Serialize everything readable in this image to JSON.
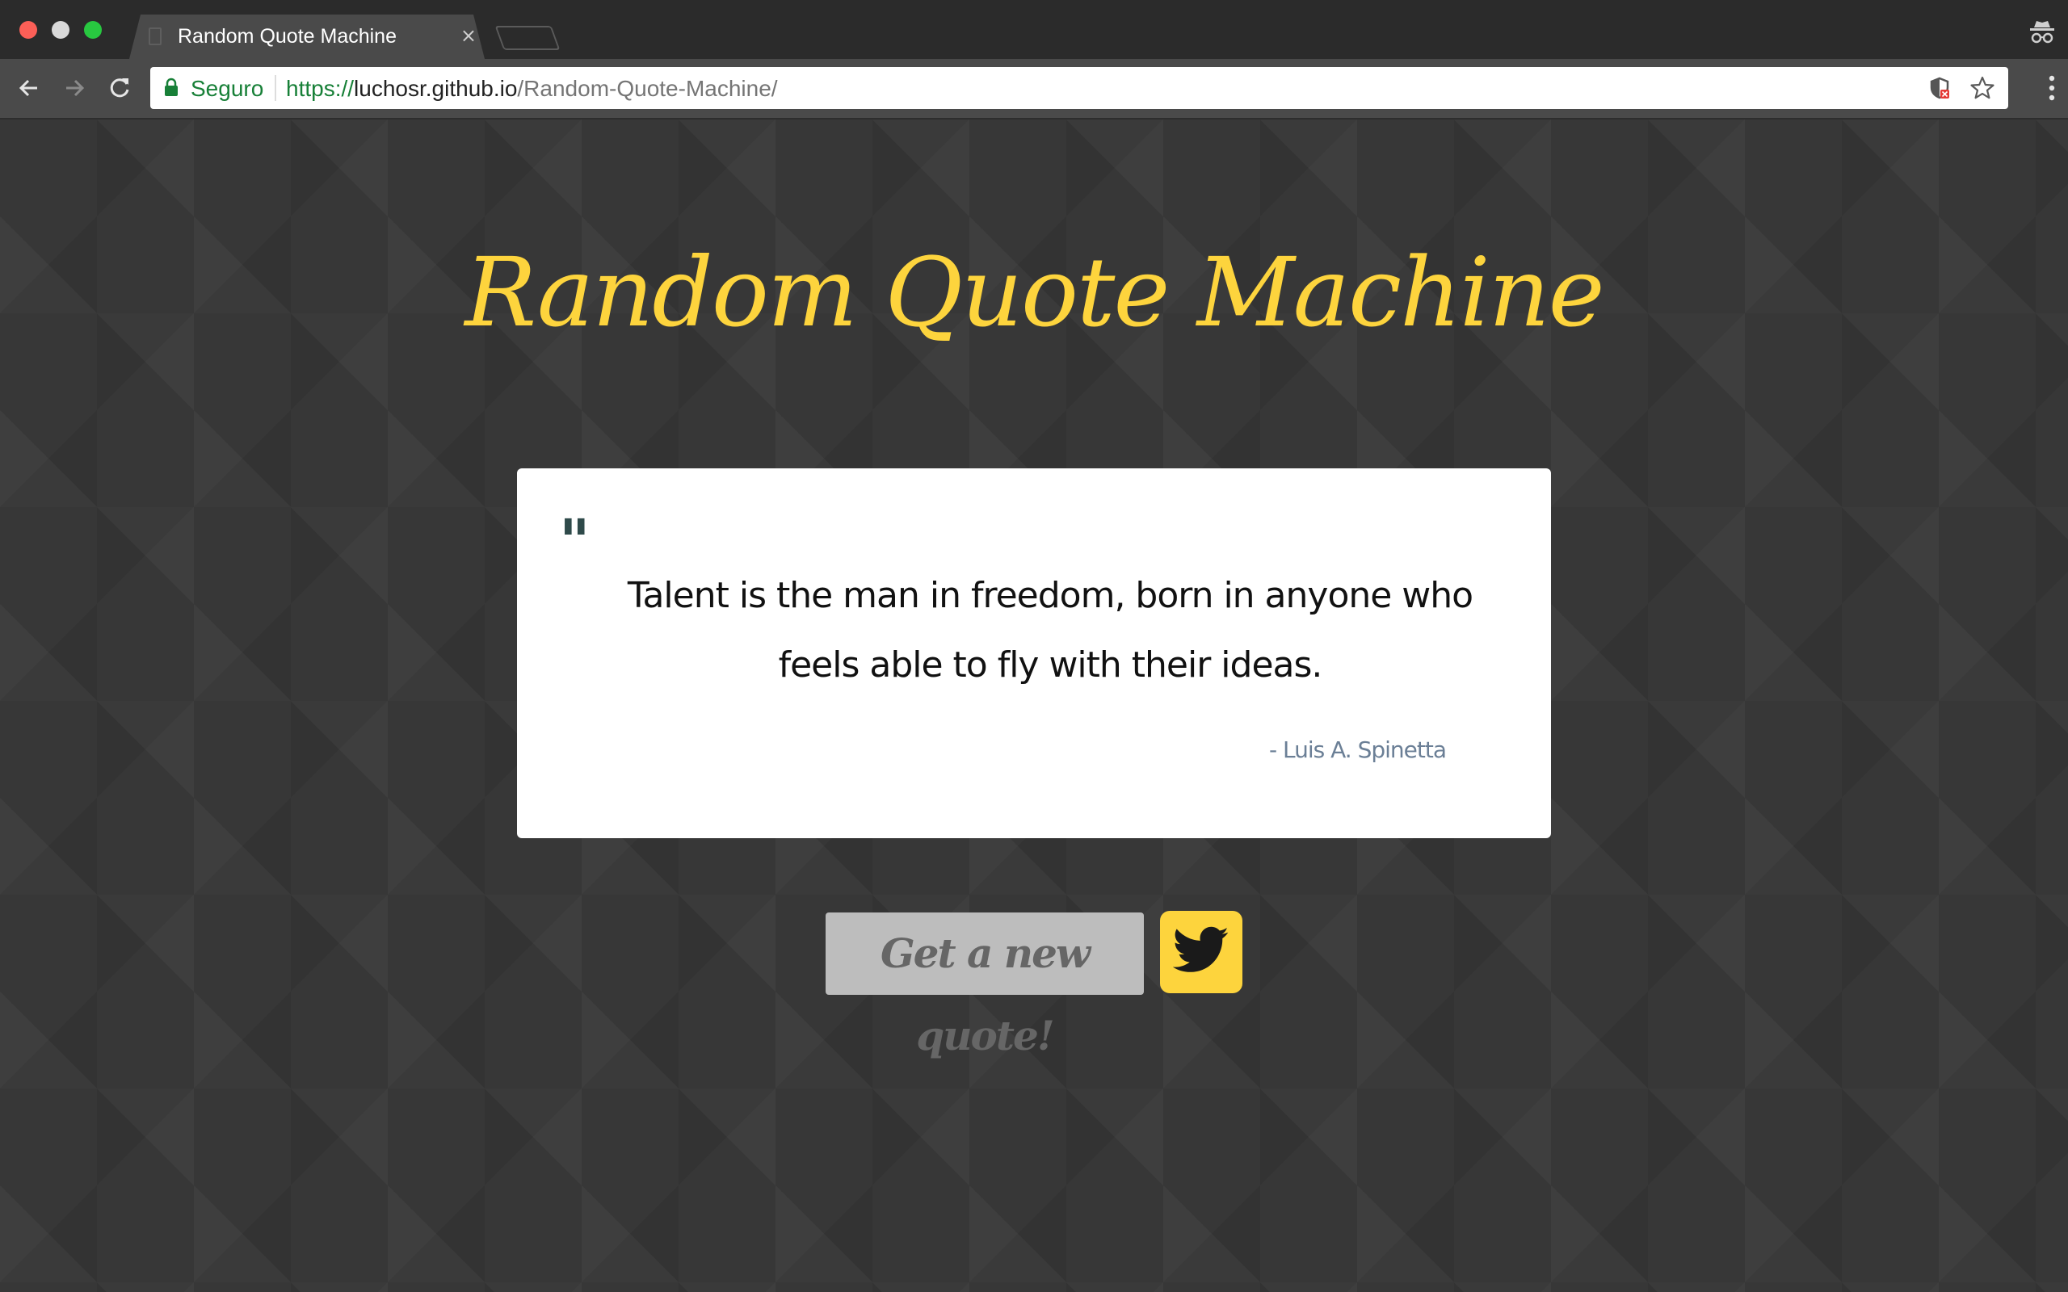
{
  "browser": {
    "tab": {
      "title": "Random Quote Machine",
      "close_symbol": "×",
      "favicon": "document-icon"
    },
    "toolbar": {
      "back_icon": "arrow-left-icon",
      "forward_icon": "arrow-right-icon",
      "reload_icon": "reload-icon",
      "secure_label": "Seguro",
      "url": {
        "scheme": "https://",
        "host": "luchosr.github.io",
        "path": "/Random-Quote-Machine/"
      },
      "extension_icon": "shield-icon",
      "bookmark_icon": "star-icon",
      "menu_icon": "vertical-dots-icon"
    },
    "incognito_icon": "incognito-icon"
  },
  "page": {
    "title": "Random Quote Machine",
    "quote": {
      "mark": "\"",
      "text": "Talent is the man in freedom, born in anyone who feels able to fly with their ideas.",
      "author": "- Luis A. Spinetta"
    },
    "buttons": {
      "new_quote": "Get a new quote!",
      "tweet_icon": "twitter-bird-icon"
    }
  },
  "colors": {
    "accent_yellow": "#fdd43d",
    "page_background": "#373737",
    "card_background": "#ffffff",
    "author_color": "#6b7f96",
    "secure_green": "#188038",
    "button_gray": "#bdbdbd"
  }
}
